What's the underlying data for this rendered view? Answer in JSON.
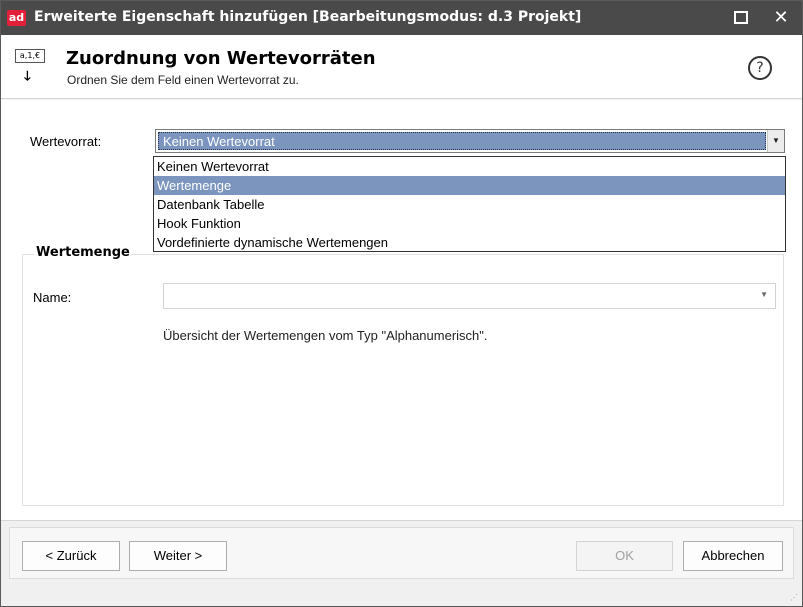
{
  "window": {
    "app_icon_text": "ad",
    "title": "Erweiterte Eigenschaft hinzufügen  [Bearbeitungsmodus: d.3 Projekt]",
    "maximize_symbol": "□",
    "close_symbol": "✕"
  },
  "header": {
    "icon_tag": "a,1,€",
    "icon_arrow": "🡓",
    "title": "Zuordnung von Wertevorräten",
    "subtitle": "Ordnen Sie dem Feld einen Wertevorrat zu.",
    "help_symbol": "?"
  },
  "form": {
    "wertevorrat_label": "Wertevorrat:",
    "wertevorrat_value": "Keinen Wertevorrat",
    "dropdown_arrow": "▼",
    "options": [
      {
        "label": "Keinen Wertevorrat",
        "selected": false
      },
      {
        "label": "Wertemenge",
        "selected": true
      },
      {
        "label": "Datenbank Tabelle",
        "selected": false
      },
      {
        "label": "Hook Funktion",
        "selected": false
      },
      {
        "label": "Vordefinierte dynamische Wertemengen",
        "selected": false
      }
    ]
  },
  "group": {
    "title": "Wertemenge",
    "name_label": "Name:",
    "name_value": "",
    "name_arrow": "▼",
    "info_text": "Übersicht der Wertemengen vom Typ \"Alphanumerisch\"."
  },
  "footer": {
    "back_label": "< Zurück",
    "next_label": "Weiter >",
    "ok_label": "OK",
    "cancel_label": "Abbrechen",
    "grip_symbol": "⋰"
  },
  "colors": {
    "titlebar": "#4a4a4a",
    "app_icon": "#e2203a",
    "selection": "#7c95bf"
  }
}
